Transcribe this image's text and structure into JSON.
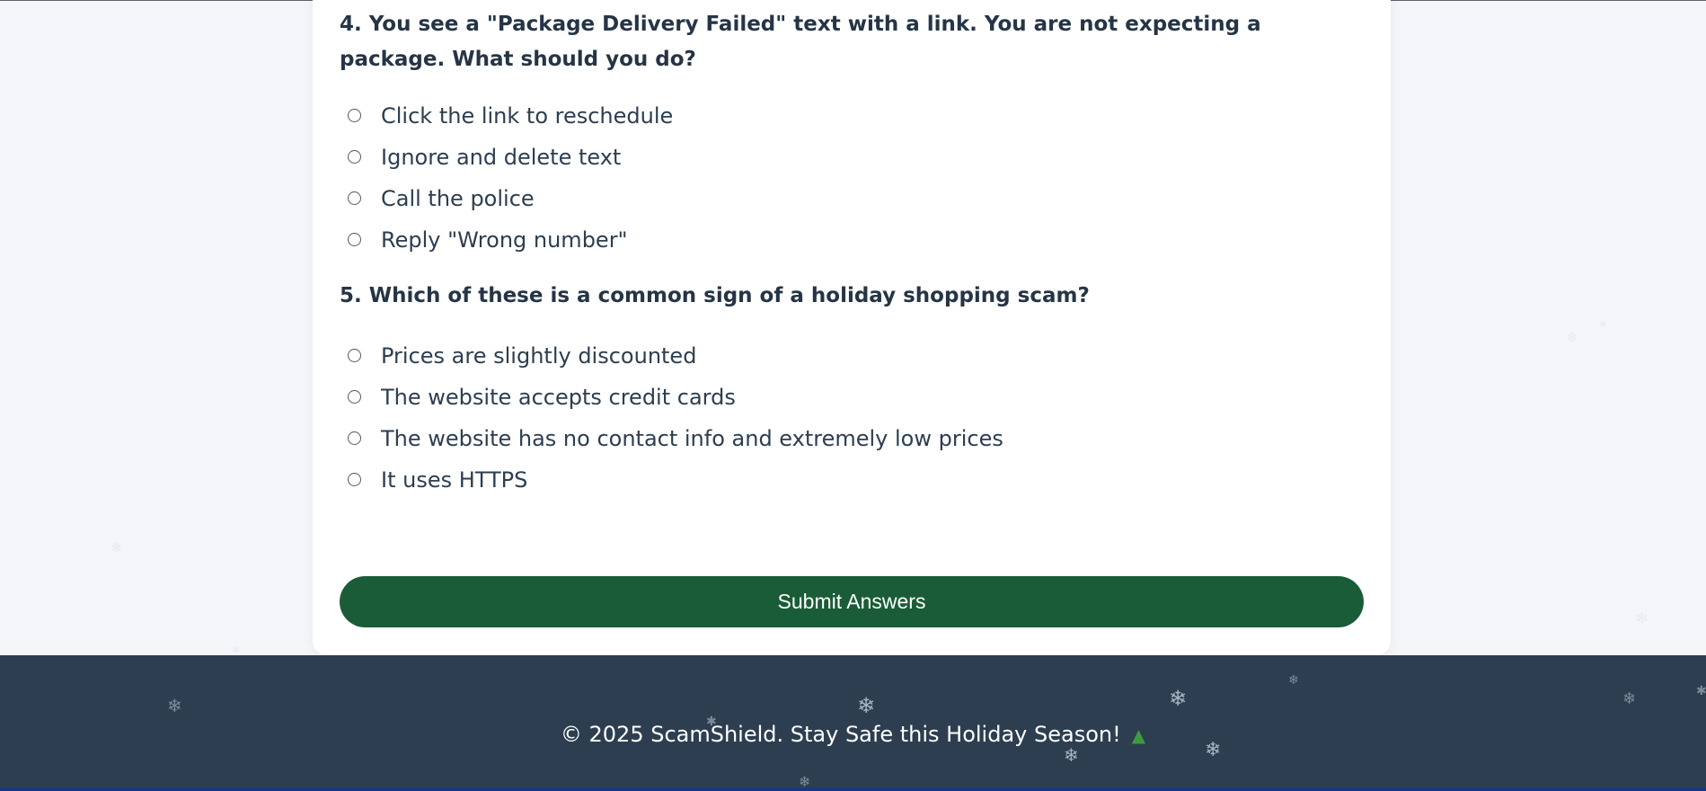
{
  "quiz": {
    "questions": [
      {
        "title": "4. You see a \"Package Delivery Failed\" text with a link. You are not expecting a package. What should you do?",
        "options": [
          "Click the link to reschedule",
          "Ignore and delete text",
          "Call the police",
          "Reply \"Wrong number\""
        ]
      },
      {
        "title": "5. Which of these is a common sign of a holiday shopping scam?",
        "options": [
          "Prices are slightly discounted",
          "The website accepts credit cards",
          "The website has no contact info and extremely low prices",
          "It uses HTTPS"
        ]
      }
    ],
    "submit_label": "Submit Answers"
  },
  "footer": {
    "text": "© 2025 ScamShield. Stay Safe this Holiday Season!",
    "icon": "christmas-tree-icon"
  },
  "colors": {
    "page_background": "#f4f6f9",
    "card_background": "#ffffff",
    "question_text": "#263545",
    "option_text": "#2c3e50",
    "submit_button": "#1a5c37",
    "footer_background": "#2d3e50"
  }
}
